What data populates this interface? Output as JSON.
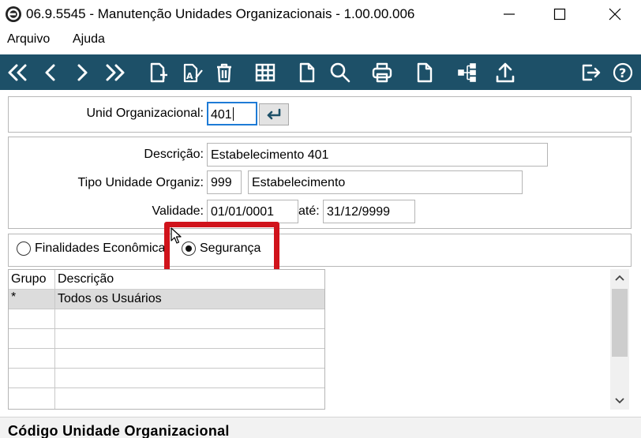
{
  "window": {
    "title": "06.9.5545 - Manutenção Unidades Organizacionais - 1.00.00.006",
    "app_icon": "power-circle-icon",
    "controls": [
      "minimize-icon",
      "maximize-icon",
      "close-icon"
    ]
  },
  "menu": {
    "items": [
      {
        "label": "Arquivo"
      },
      {
        "label": "Ajuda"
      }
    ]
  },
  "toolbar": {
    "color": "#1d5068",
    "icons": [
      "first-record-icon",
      "previous-record-icon",
      "next-record-icon",
      "last-record-icon",
      "new-record-icon",
      "edit-record-icon",
      "delete-icon",
      "grid-view-icon",
      "blank-document-icon",
      "search-icon",
      "print-icon",
      "document-icon",
      "hierarchy-icon",
      "export-icon",
      "exit-icon",
      "help-icon"
    ]
  },
  "form": {
    "unid_label": "Unid Organizacional:",
    "unid_value": "401",
    "descricao_label": "Descrição:",
    "descricao_value": "Estabelecimento 401",
    "tipo_label": "Tipo Unidade Organiz:",
    "tipo_code": "999",
    "tipo_desc": "Estabelecimento",
    "validade_label": "Validade:",
    "validade_de": "01/01/0001",
    "ate_label": "até:",
    "validade_ate": "31/12/9999"
  },
  "tabs": {
    "options": [
      {
        "label": "Finalidades Econômica",
        "checked": false
      },
      {
        "label": "Segurança",
        "checked": true
      }
    ],
    "highlight_color": "#d0131b"
  },
  "grid": {
    "columns": [
      "Grupo",
      "Descrição"
    ],
    "rows": [
      {
        "grupo": "*",
        "descricao": "Todos os Usuários"
      }
    ],
    "selected_row_color": "#dcdcdc"
  },
  "status": {
    "text": "Código Unidade Organizacional"
  }
}
